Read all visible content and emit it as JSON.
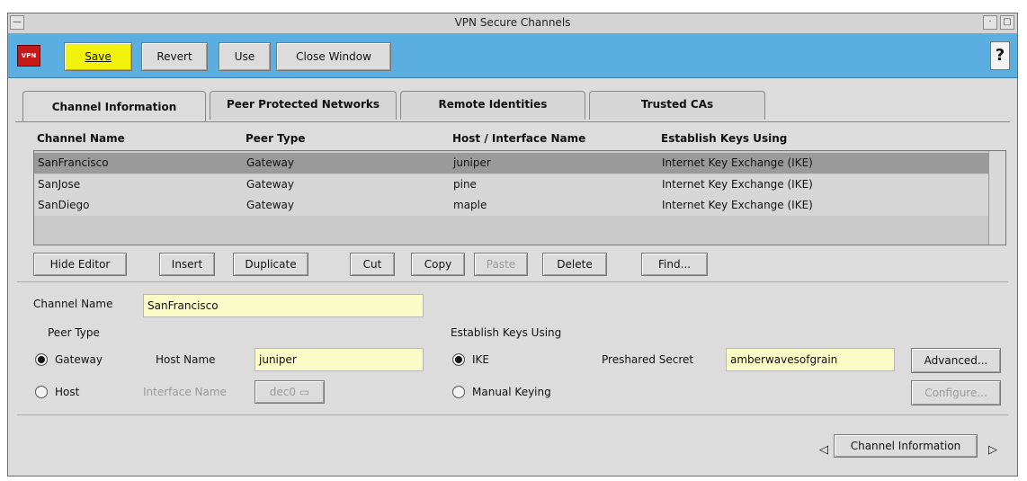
{
  "window": {
    "title": "VPN Secure Channels"
  },
  "toolbar": {
    "logo": "VPN",
    "save": "Save",
    "revert": "Revert",
    "use": "Use",
    "close": "Close Window",
    "help": "?"
  },
  "tabs": [
    {
      "label": "Channel Information",
      "active": true
    },
    {
      "label": "Peer Protected Networks",
      "active": false
    },
    {
      "label": "Remote Identities",
      "active": false
    },
    {
      "label": "Trusted CAs",
      "active": false
    }
  ],
  "table": {
    "columns": [
      "Channel Name",
      "Peer Type",
      "Host / Interface Name",
      "Establish Keys Using"
    ],
    "rows": [
      [
        "SanFrancisco",
        "Gateway",
        "juniper",
        "Internet Key Exchange (IKE)"
      ],
      [
        "SanJose",
        "Gateway",
        "pine",
        "Internet Key Exchange (IKE)"
      ],
      [
        "SanDiego",
        "Gateway",
        "maple",
        "Internet Key Exchange (IKE)"
      ]
    ]
  },
  "list_buttons": {
    "hide_editor": "Hide Editor",
    "insert": "Insert",
    "duplicate": "Duplicate",
    "cut": "Cut",
    "copy": "Copy",
    "paste": "Paste",
    "delete": "Delete",
    "find": "Find..."
  },
  "editor": {
    "channel_name_label": "Channel Name",
    "channel_name_value": "SanFrancisco",
    "peer_type_label": "Peer Type",
    "gateway_label": "Gateway",
    "host_label": "Host",
    "host_name_label": "Host Name",
    "host_name_value": "juniper",
    "interface_name_label": "Interface Name",
    "interface_value": "dec0",
    "establish_keys_label": "Establish Keys Using",
    "ike_label": "IKE",
    "manual_label": "Manual Keying",
    "preshared_label": "Preshared Secret",
    "preshared_value": "amberwavesofgrain",
    "advanced": "Advanced...",
    "configure": "Configure..."
  },
  "footer": {
    "page_label": "Channel Information"
  },
  "colors": {
    "toolbar": "#5aaee0",
    "save": "#f2f20c",
    "field": "#fbfbc8",
    "selected_row": "#9a9a9a"
  }
}
